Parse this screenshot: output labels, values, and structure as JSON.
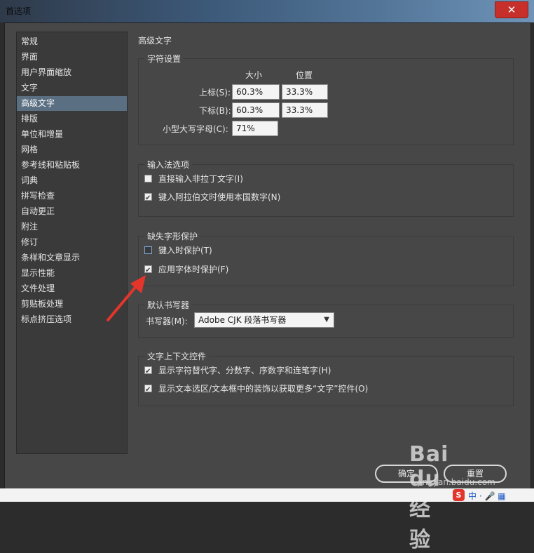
{
  "window": {
    "title": "首选项",
    "close_glyph": "✕"
  },
  "sidebar": {
    "items": [
      {
        "label": "常规"
      },
      {
        "label": "界面"
      },
      {
        "label": "用户界面缩放"
      },
      {
        "label": "文字"
      },
      {
        "label": "高级文字",
        "selected": true
      },
      {
        "label": "排版"
      },
      {
        "label": "单位和增量"
      },
      {
        "label": "网格"
      },
      {
        "label": "参考线和粘贴板"
      },
      {
        "label": "词典"
      },
      {
        "label": "拼写检查"
      },
      {
        "label": "自动更正"
      },
      {
        "label": "附注"
      },
      {
        "label": "修订"
      },
      {
        "label": "条样和文章显示"
      },
      {
        "label": "显示性能"
      },
      {
        "label": "文件处理"
      },
      {
        "label": "剪贴板处理"
      },
      {
        "label": "标点挤压选项"
      }
    ]
  },
  "main": {
    "section_title": "高级文字",
    "char_settings": {
      "title": "字符设置",
      "col_size": "大小",
      "col_position": "位置",
      "superscript": {
        "label": "上标(S):",
        "size": "60.3%",
        "position": "33.3%"
      },
      "subscript": {
        "label": "下标(B):",
        "size": "60.3%",
        "position": "33.3%"
      },
      "small_caps": {
        "label": "小型大写字母(C):",
        "size": "71%"
      }
    },
    "input_method": {
      "title": "输入法选项",
      "direct_input": {
        "label": "直接输入非拉丁文字(I)",
        "checked": false
      },
      "arabic_digits": {
        "label": "键入阿拉伯文时使用本国数字(N)",
        "checked": true
      }
    },
    "missing_glyph": {
      "title": "缺失字形保护",
      "protect_typing": {
        "label": "键入时保护(T)",
        "checked": false
      },
      "protect_font": {
        "label": "应用字体时保护(F)",
        "checked": true
      }
    },
    "default_composer": {
      "title": "默认书写器",
      "label": "书写器(M):",
      "value": "Adobe CJK 段落书写器"
    },
    "context_controls": {
      "title": "文字上下文控件",
      "show_alternates": {
        "label": "显示字符替代字、分数字、序数字和连笔字(H)",
        "checked": true
      },
      "show_adornment": {
        "label": "显示文本选区/文本框中的装饰以获取更多“文字”控件(O)",
        "checked": true
      }
    }
  },
  "buttons": {
    "ok": "确定",
    "reset": "重置"
  },
  "watermark": {
    "logo": "Bai du 经验",
    "url": "jingyan.baidu.com"
  },
  "taskbar": {
    "ime_logo": "S",
    "ime_text": "中 · 🎤 ▦"
  },
  "colors": {
    "selection": "#5b6f82",
    "arrow": "#e5352b",
    "panel": "#474747"
  }
}
